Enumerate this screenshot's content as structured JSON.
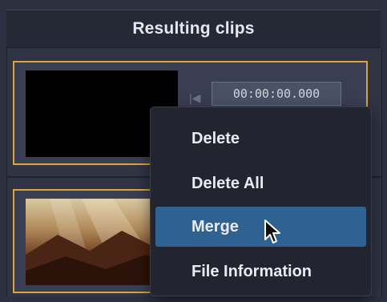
{
  "panel": {
    "title": "Resulting clips"
  },
  "clips": [
    {
      "timecode": "00:00:00.000",
      "thumbnail": "black-frame"
    },
    {
      "thumbnail": "mountain-sunrays-frame"
    }
  ],
  "context_menu": {
    "items": [
      {
        "label": "Delete"
      },
      {
        "label": "Delete All"
      },
      {
        "label": "Merge",
        "highlighted": true
      },
      {
        "label": "File Information"
      }
    ]
  },
  "colors": {
    "selection_border": "#d9a53c",
    "menu_highlight": "#2f6291",
    "menu_background": "#22252f"
  },
  "icons": [
    "previous-frame-icon",
    "mouse-pointer-icon"
  ]
}
